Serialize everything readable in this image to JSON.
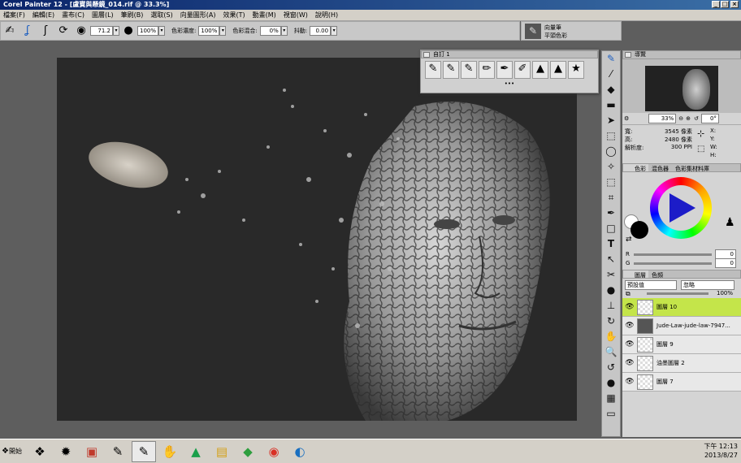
{
  "window": {
    "title": "Corel Painter 12 - [盧寶與懸鏡_014.rif @ 33.3%]"
  },
  "menu": [
    "檔案(F)",
    "編輯(E)",
    "畫布(C)",
    "圖層(L)",
    "筆刷(B)",
    "選取(S)",
    "向量圖形(A)",
    "效果(T)",
    "動畫(M)",
    "視窗(W)",
    "說明(H)"
  ],
  "propbar": {
    "size": "71.2",
    "opacity": "100%",
    "resat_label": "色彩濃度:",
    "resat": "100%",
    "bleed_label": "色彩混合:",
    "bleed": "0%",
    "jitter_label": "抖動:",
    "jitter": "0.00"
  },
  "brush_selector": {
    "category": "向量筆",
    "variant": "平頭色彩"
  },
  "custom_palette": {
    "title": "自訂 1",
    "icons": [
      "brush-icon",
      "brush-icon",
      "brush-icon",
      "pencil-icon",
      "pen-icon",
      "airbrush-icon",
      "blender-icon",
      "stamp-icon",
      "sparkle-icon"
    ]
  },
  "navigator": {
    "title": "導覽",
    "zoom": "33%",
    "rotate": "0°",
    "width_label": "寬:",
    "width": "3545 像素",
    "height_label": "高:",
    "height": "2480 像素",
    "res_label": "解析度:",
    "resolution": "300 PPI",
    "x_label": "X:",
    "y_label": "Y:",
    "w_label": "W:",
    "h_label": "H:"
  },
  "color_panel": {
    "tabs": [
      "色彩",
      "混色器",
      "色彩集材料庫"
    ],
    "r_label": "R",
    "g_label": "G",
    "r": "0",
    "g": "0"
  },
  "layers_panel": {
    "tabs": [
      "圖層",
      "色頻"
    ],
    "blend": "預設值",
    "composite": "忽略",
    "opacity": "100%",
    "layers": [
      {
        "name": "圖層 10",
        "selected": true
      },
      {
        "name": "Jude-Law-jude-law-7947..."
      },
      {
        "name": "圖層 9"
      },
      {
        "name": "油墨圖層 2"
      },
      {
        "name": "圖層 7"
      }
    ]
  },
  "taskbar": {
    "start": "開始",
    "time": "下午 12:13",
    "date": "2013/8/27"
  },
  "colors": {
    "selected_layer": "#c4e54a",
    "title_bar": "#0a246a"
  }
}
